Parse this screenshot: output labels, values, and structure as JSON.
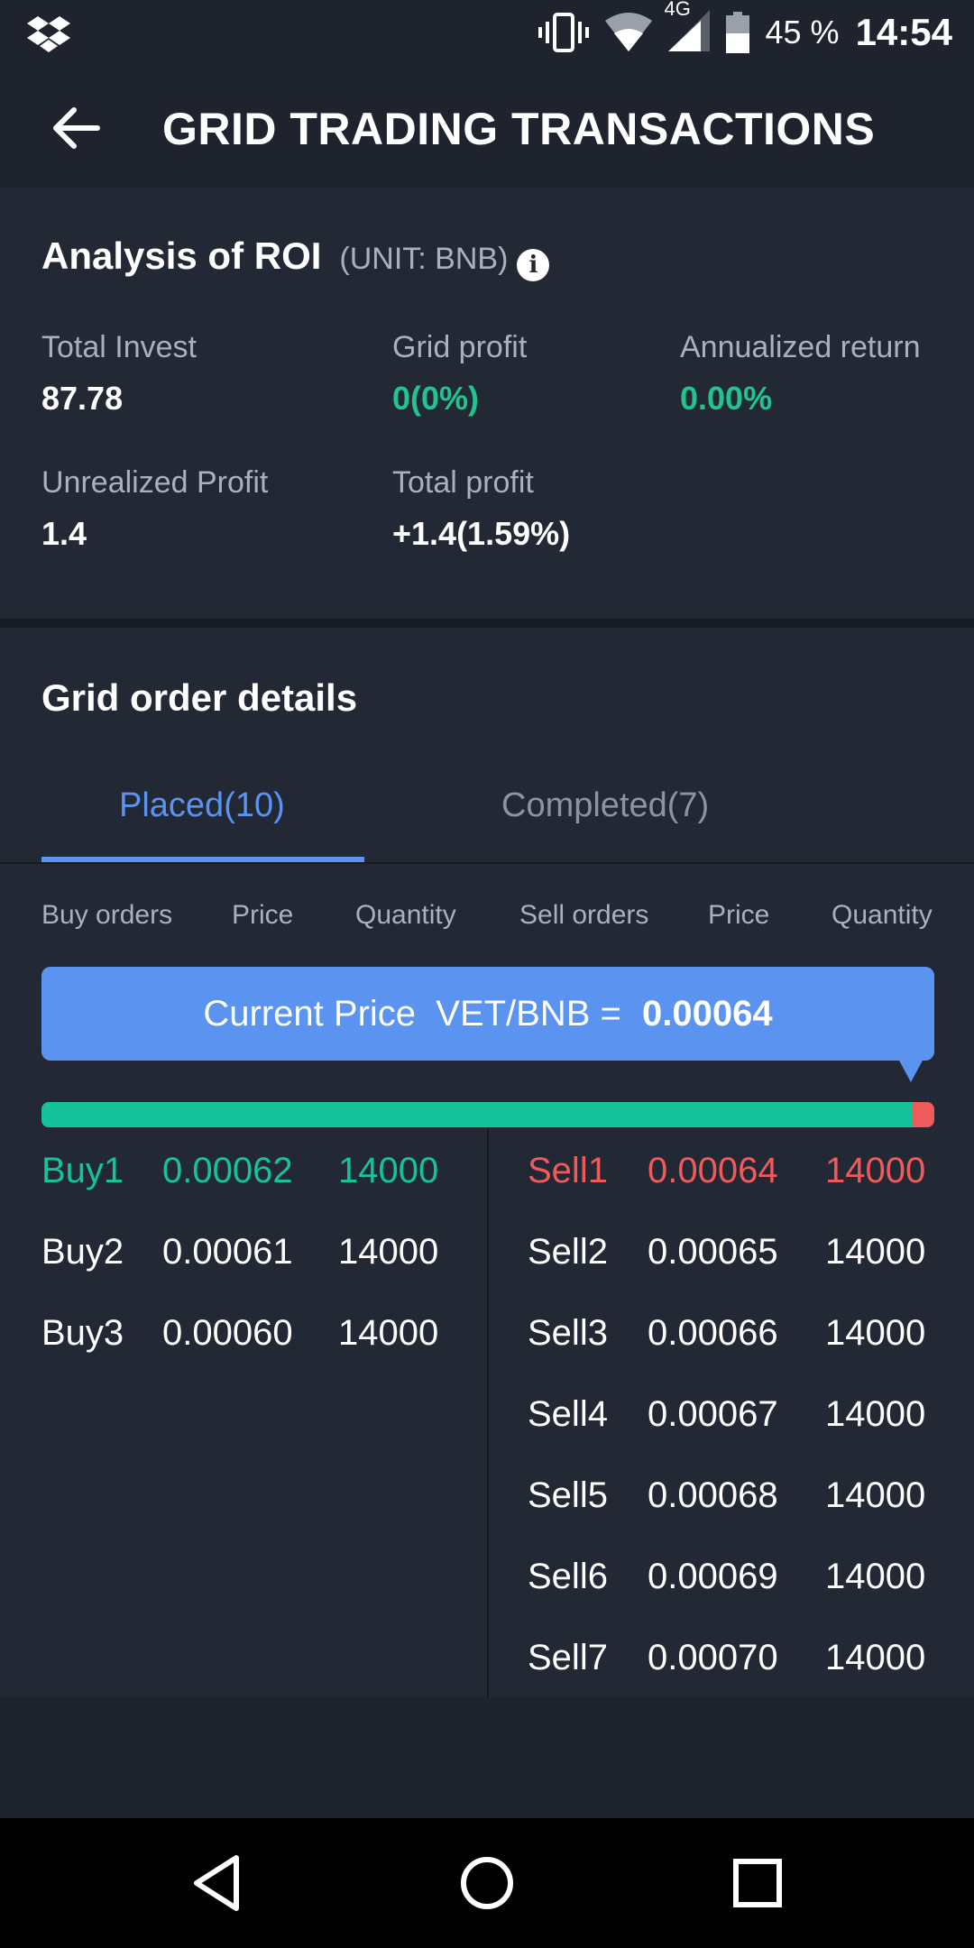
{
  "status": {
    "battery_percent": "45 %",
    "network": "4G",
    "time": "14:54"
  },
  "header": {
    "title": "GRID TRADING TRANSACTIONS"
  },
  "roi": {
    "title": "Analysis of ROI",
    "unit": "(UNIT: BNB)",
    "info_glyph": "i",
    "total_invest_label": "Total Invest",
    "total_invest_value": "87.78",
    "grid_profit_label": "Grid profit",
    "grid_profit_value": "0(0%)",
    "annualized_label": "Annualized return",
    "annualized_value": "0.00%",
    "unrealized_label": "Unrealized Profit",
    "unrealized_value": "1.4",
    "total_profit_label": "Total profit",
    "total_profit_value": "+1.4(1.59%)"
  },
  "details": {
    "title": "Grid order details",
    "tabs": {
      "placed": "Placed(10)",
      "completed": "Completed(7)"
    },
    "columns": [
      "Buy orders",
      "Price",
      "Quantity",
      "Sell orders",
      "Price",
      "Quantity"
    ],
    "current_price_label": "Current Price  VET/BNB = ",
    "current_price_value": "0.00064",
    "buy_share": 0.975,
    "buy_orders": [
      {
        "name": "Buy1",
        "price": "0.00062",
        "qty": "14000"
      },
      {
        "name": "Buy2",
        "price": "0.00061",
        "qty": "14000"
      },
      {
        "name": "Buy3",
        "price": "0.00060",
        "qty": "14000"
      }
    ],
    "sell_orders": [
      {
        "name": "Sell1",
        "price": "0.00064",
        "qty": "14000"
      },
      {
        "name": "Sell2",
        "price": "0.00065",
        "qty": "14000"
      },
      {
        "name": "Sell3",
        "price": "0.00066",
        "qty": "14000"
      },
      {
        "name": "Sell4",
        "price": "0.00067",
        "qty": "14000"
      },
      {
        "name": "Sell5",
        "price": "0.00068",
        "qty": "14000"
      },
      {
        "name": "Sell6",
        "price": "0.00069",
        "qty": "14000"
      },
      {
        "name": "Sell7",
        "price": "0.00070",
        "qty": "14000"
      }
    ]
  },
  "colors": {
    "accent": "#5b93f0",
    "buy": "#14c39a",
    "sell": "#f05a5a",
    "background": "#232835"
  }
}
